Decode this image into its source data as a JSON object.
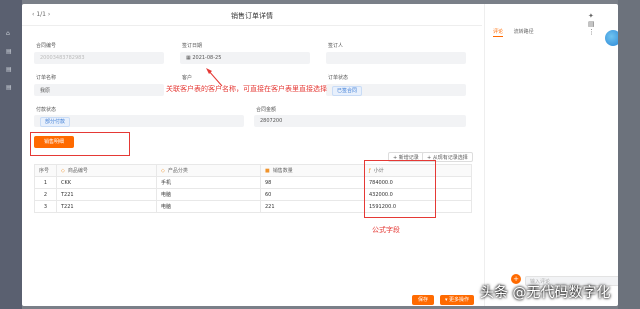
{
  "window": {
    "nav": "1/1",
    "title": "销售订单详情"
  },
  "fields": {
    "order_no": {
      "label": "合同编号",
      "value": "20003483782983"
    },
    "order_date": {
      "label": "签订日期",
      "value": "2021-08-25"
    },
    "signer": {
      "label": "签订人",
      "value": ""
    },
    "order_name": {
      "label": "订单名称",
      "value": "我原"
    },
    "customer": {
      "label": "客户",
      "value": ""
    },
    "order_status": {
      "label": "订单状态",
      "value": "已签合同"
    },
    "payment_status": {
      "label": "付款状态",
      "value": "部分付款"
    },
    "contract_amount": {
      "label": "合同金额",
      "value": "2807200"
    }
  },
  "annotations": {
    "customer_note": "关联客户表的客户名称，可直接在客户表里直接选择",
    "formula_note": "公式字段"
  },
  "section": {
    "label": "销售明细"
  },
  "toolbar": {
    "add_label": "+ 新增记录",
    "select_label": "+ 从现有记录选择"
  },
  "table": {
    "headers": [
      "序号",
      "商品编号",
      "产品分类",
      "销售数量",
      "小计"
    ],
    "rows": [
      [
        "1",
        "CKK",
        "手机",
        "98",
        "784000.0"
      ],
      [
        "2",
        "T221",
        "电脑",
        "60",
        "432000.0"
      ],
      [
        "3",
        "T221",
        "电脑",
        "221",
        "1591200.0"
      ]
    ]
  },
  "side": {
    "tab_comment": "评论",
    "tab_flow": "流转路径",
    "comment_placeholder": "输入评论"
  },
  "footer": {
    "save": "保存",
    "more": "▾ 更多操作"
  },
  "watermark": "头条 @无代码数字化",
  "colors": {
    "accent": "#ff6a00",
    "annotation": "#e53935"
  }
}
